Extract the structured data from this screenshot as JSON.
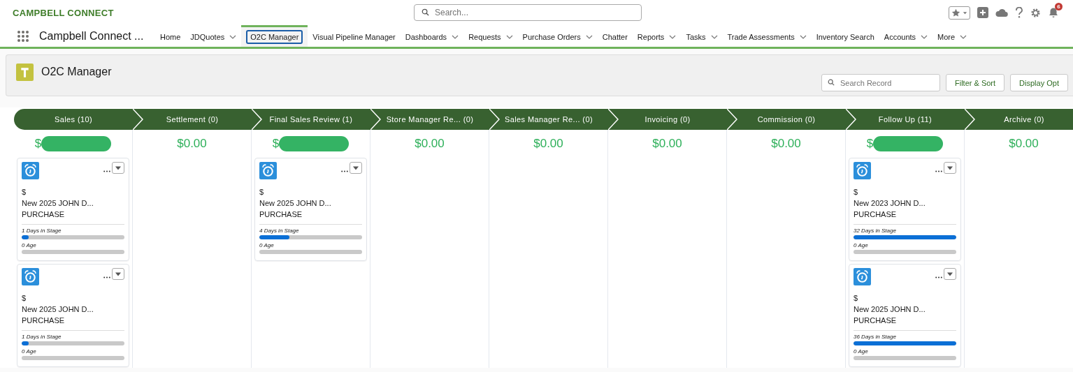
{
  "logo": "CAMPBELL CONNECT",
  "search": {
    "placeholder": "Search..."
  },
  "notifications": {
    "count": "6"
  },
  "app_name": "Campbell Connect ...",
  "nav": [
    {
      "label": "Home",
      "has_menu": false,
      "selected": false
    },
    {
      "label": "JDQuotes",
      "has_menu": true,
      "selected": false
    },
    {
      "label": "O2C Manager",
      "has_menu": false,
      "selected": true
    },
    {
      "label": "Visual Pipeline Manager",
      "has_menu": false,
      "selected": false
    },
    {
      "label": "Dashboards",
      "has_menu": true,
      "selected": false
    },
    {
      "label": "Requests",
      "has_menu": true,
      "selected": false
    },
    {
      "label": "Purchase Orders",
      "has_menu": true,
      "selected": false
    },
    {
      "label": "Chatter",
      "has_menu": false,
      "selected": false
    },
    {
      "label": "Reports",
      "has_menu": true,
      "selected": false
    },
    {
      "label": "Tasks",
      "has_menu": true,
      "selected": false
    },
    {
      "label": "Trade Assessments",
      "has_menu": true,
      "selected": false
    },
    {
      "label": "Inventory Search",
      "has_menu": false,
      "selected": false
    },
    {
      "label": "Accounts",
      "has_menu": true,
      "selected": false
    },
    {
      "label": "More",
      "has_menu": true,
      "selected": false
    }
  ],
  "page_title": "O2C Manager",
  "record_search": {
    "placeholder": "Search Record"
  },
  "buttons": [
    "Filter & Sort",
    "Display Opt"
  ],
  "stages": [
    {
      "label": "Sales (10)",
      "amount": "$",
      "redacted": true,
      "cards": [
        {
          "amount": "$",
          "title": "New 2025 JOHN D...",
          "type": "PURCHASE",
          "meters": [
            {
              "label": "1 Days in Stage",
              "level": 0.07
            },
            {
              "label": "0 Age",
              "level": 0
            }
          ]
        },
        {
          "amount": "$",
          "title": "New 2025 JOHN D...",
          "type": "PURCHASE",
          "meters": [
            {
              "label": "1 Days in Stage",
              "level": 0.07
            },
            {
              "label": "0 Age",
              "level": 0
            }
          ]
        }
      ]
    },
    {
      "label": "Settlement (0)",
      "amount": "$0.00",
      "redacted": false
    },
    {
      "label": "Final Sales Review (1)",
      "amount": "$",
      "redacted": true,
      "cards": [
        {
          "amount": "$",
          "title": "New 2025 JOHN D...",
          "type": "PURCHASE",
          "meters": [
            {
              "label": "4 Days in Stage",
              "level": 0.29
            },
            {
              "label": "0 Age",
              "level": 0
            }
          ]
        }
      ]
    },
    {
      "label": "Store Manager Re...  (0)",
      "amount": "$0.00",
      "redacted": false
    },
    {
      "label": "Sales Manager Re...  (0)",
      "amount": "$0.00",
      "redacted": false
    },
    {
      "label": "Invoicing (0)",
      "amount": "$0.00",
      "redacted": false
    },
    {
      "label": "Commission (0)",
      "amount": "$0.00",
      "redacted": false
    },
    {
      "label": "Follow Up (11)",
      "amount": "$",
      "redacted": true,
      "cards": [
        {
          "amount": "$",
          "title": "New 2023 JOHN D...",
          "type": "PURCHASE",
          "meters": [
            {
              "label": "32 Days in Stage",
              "level": 1
            },
            {
              "label": "0 Age",
              "level": 0
            }
          ]
        },
        {
          "amount": "$",
          "title": "New 2025 JOHN D...",
          "type": "PURCHASE",
          "meters": [
            {
              "label": "36 Days in Stage",
              "level": 1
            },
            {
              "label": "0 Age",
              "level": 0
            }
          ]
        }
      ]
    },
    {
      "label": "Archive (0)",
      "amount": "$0.00",
      "redacted": false
    }
  ]
}
